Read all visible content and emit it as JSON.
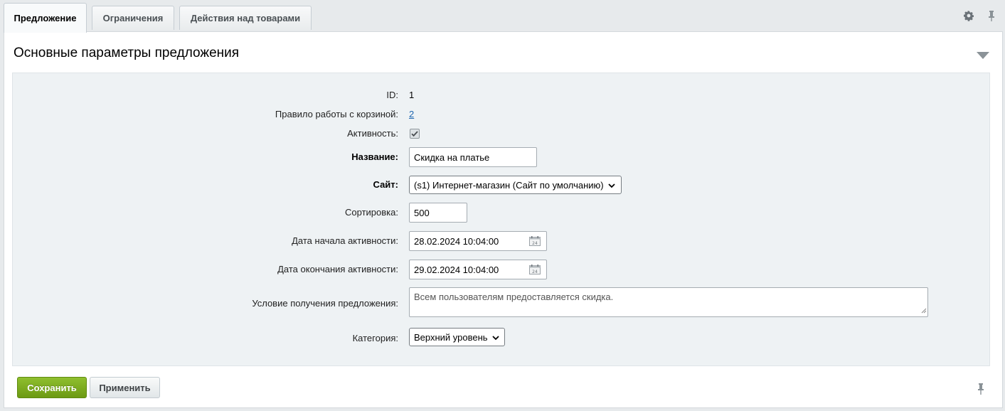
{
  "tabs": [
    {
      "label": "Предложение",
      "active": true
    },
    {
      "label": "Ограничения",
      "active": false
    },
    {
      "label": "Действия над товарами",
      "active": false
    }
  ],
  "tab_icons": {
    "settings": "gear-icon",
    "pin": "pin-icon"
  },
  "section": {
    "title": "Основные параметры предложения",
    "collapse_icon": "triangle-down-icon"
  },
  "form": {
    "id": {
      "label": "ID:",
      "value": "1"
    },
    "cart_rule": {
      "label": "Правило работы с корзиной:",
      "value": "2"
    },
    "active": {
      "label": "Активность:",
      "checked": true
    },
    "name": {
      "label": "Название:",
      "value": "Скидка на платье"
    },
    "site": {
      "label": "Сайт:",
      "value": "(s1) Интернет-магазин (Сайт по умолчанию)"
    },
    "sort": {
      "label": "Сортировка:",
      "value": "500"
    },
    "date_start": {
      "label": "Дата начала активности:",
      "value": "28.02.2024 10:04:00"
    },
    "date_end": {
      "label": "Дата окончания активности:",
      "value": "29.02.2024 10:04:00"
    },
    "condition": {
      "label": "Условие получения предложения:",
      "value": "Всем пользователям предоставляется скидка."
    },
    "category": {
      "label": "Категория:",
      "value": "Верхний уровень"
    }
  },
  "buttons": {
    "save": "Сохранить",
    "apply": "Применить"
  },
  "colors": {
    "save_button": "#7aab1f",
    "link": "#2067b0",
    "form_bg": "#eef2f4"
  }
}
